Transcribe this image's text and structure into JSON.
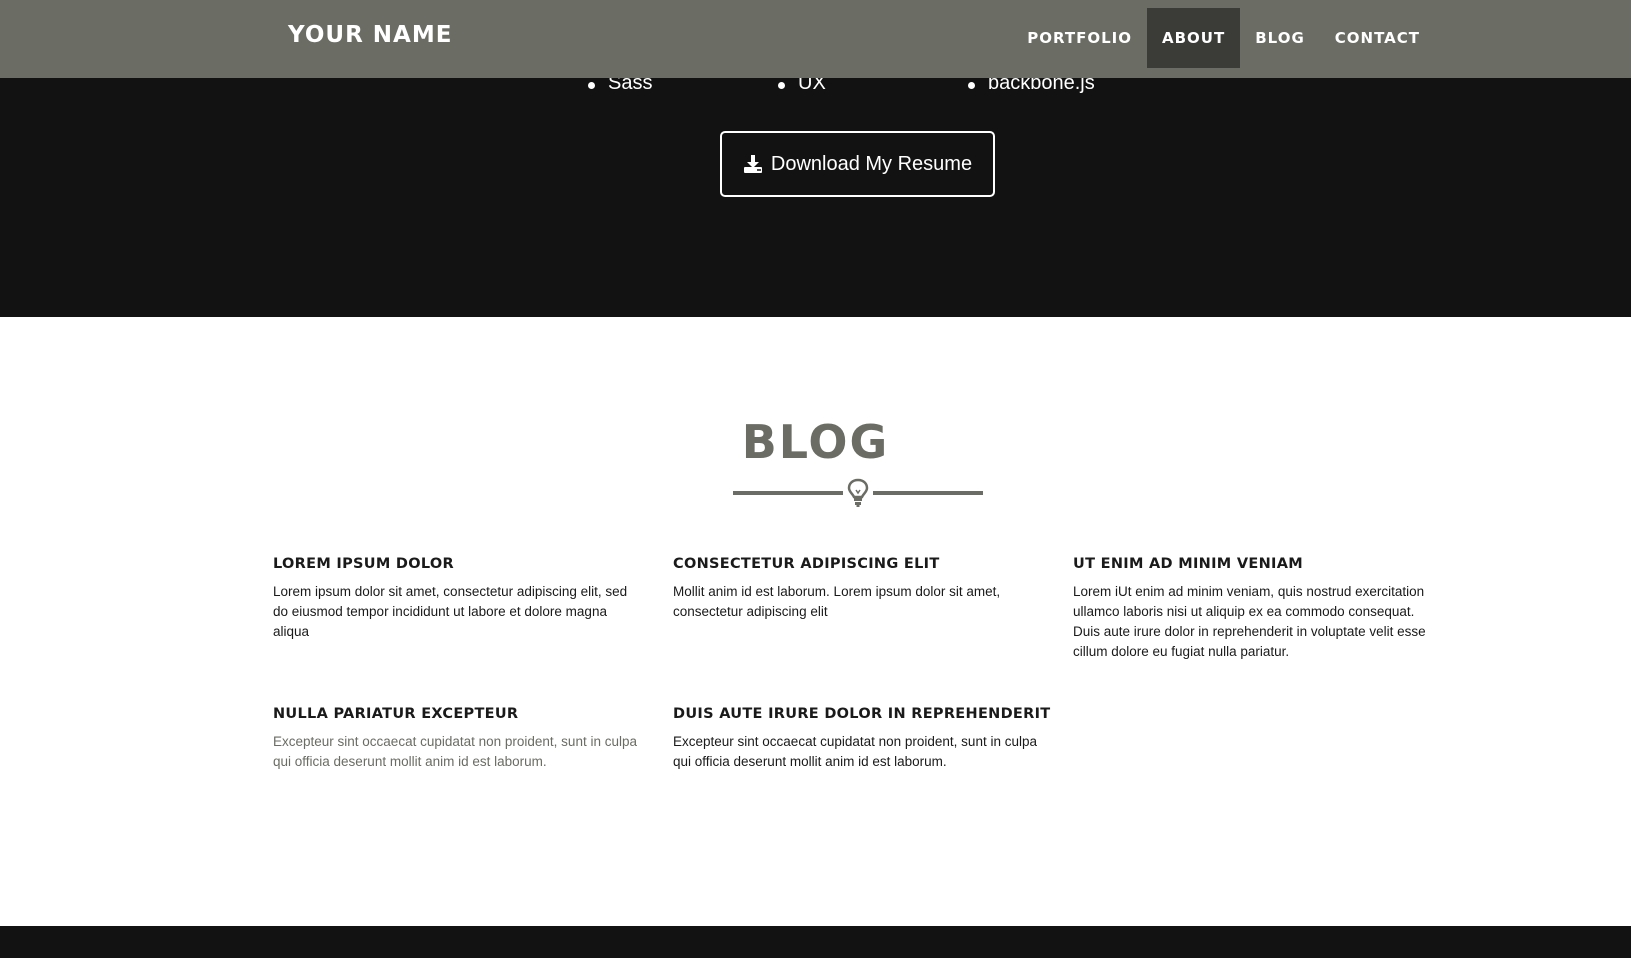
{
  "navbar": {
    "brand": "YOUR NAME",
    "items": [
      {
        "label": "PORTFOLIO",
        "active": false
      },
      {
        "label": "ABOUT",
        "active": true
      },
      {
        "label": "BLOG",
        "active": false
      },
      {
        "label": "CONTACT",
        "active": false
      }
    ]
  },
  "about": {
    "skills": [
      "Sass",
      "UX",
      "backbone.js"
    ],
    "resume_button": "Download My Resume",
    "resume_icon": "download-icon"
  },
  "blog": {
    "title": "BLOG",
    "divider_icon": "lightbulb-icon",
    "posts": [
      {
        "title": "LOREM IPSUM DOLOR",
        "body": "Lorem ipsum dolor sit amet, consectetur adipiscing elit, sed do eiusmod tempor incididunt ut labore et dolore magna aliqua"
      },
      {
        "title": "CONSECTETUR ADIPISCING ELIT",
        "body": "Mollit anim id est laborum. Lorem ipsum dolor sit amet, consectetur adipiscing elit"
      },
      {
        "title": "UT ENIM AD MINIM VENIAM",
        "body": "Lorem iUt enim ad minim veniam, quis nostrud exercitation ullamco laboris nisi ut aliquip ex ea commodo consequat. Duis aute irure dolor in reprehenderit in voluptate velit esse cillum dolore eu fugiat nulla pariatur."
      },
      {
        "title": "NULLA PARIATUR EXCEPTEUR",
        "body": "Excepteur sint occaecat cupidatat non proident, sunt in culpa qui officia deserunt mollit anim id est laborum."
      },
      {
        "title": "DUIS AUTE IRURE DOLOR IN REPREHENDERIT",
        "body": "Excepteur sint occaecat cupidatat non proident, sunt in culpa qui officia deserunt mollit anim id est laborum."
      }
    ]
  },
  "colors": {
    "navbar": "#6b6c64",
    "nav_active": "#3b3c37",
    "dark_section": "#121212",
    "accent": "#6b6c64"
  }
}
